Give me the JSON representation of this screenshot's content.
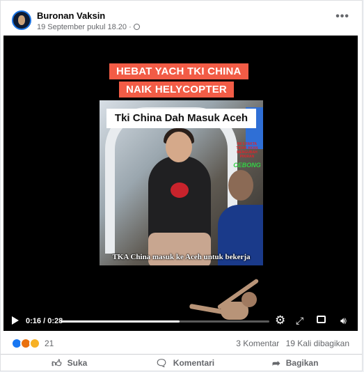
{
  "post": {
    "author": "Buronan Vaksin",
    "timestamp": "19 September pukul 18.20",
    "privacy_icon": "globe-icon",
    "more_label": "•••"
  },
  "video": {
    "banner_line1": "HEBAT YACH TKI CHINA",
    "banner_line2": "NAIK HELYCOPTER",
    "inner_caption": "Tki China Dah Masuk Aceh",
    "stamp_text": "INI 5 FAKTA TIDAK AKAN MENGUBAH PIKIRAN",
    "stamp_brand": "CEBONG",
    "subtitle": "TKA China masuk ke Aceh untuk bekerja",
    "current_time": "0:16",
    "separator": " / ",
    "duration": "0:28",
    "progress": 0.571,
    "colors": {
      "banner_bg": "#f25c46",
      "progress_fill": "#ffffff"
    }
  },
  "reactions": {
    "icons": [
      "like-icon",
      "angry-icon",
      "wow-icon"
    ],
    "count": "21",
    "comments": "3 Komentar",
    "shares": "19 Kali dibagikan"
  },
  "actions": {
    "like": "Suka",
    "comment": "Komentari",
    "share": "Bagikan"
  }
}
